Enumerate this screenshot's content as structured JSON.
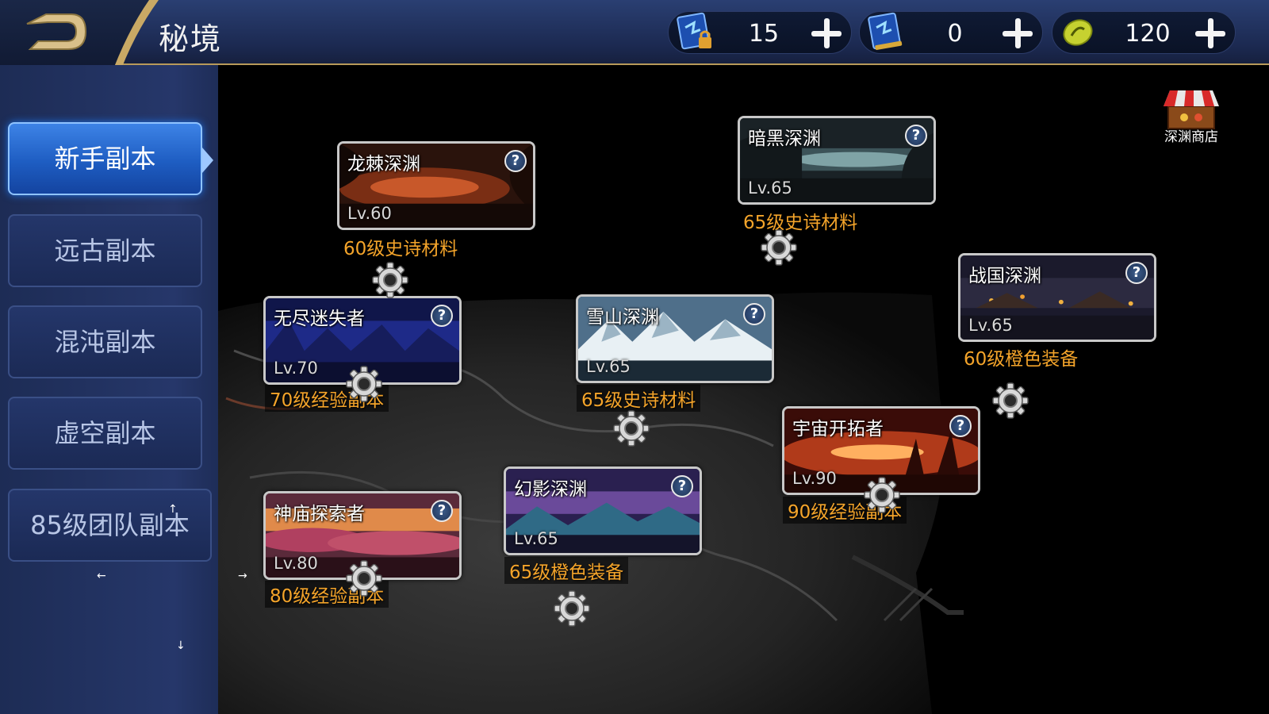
{
  "header": {
    "title": "秘境",
    "back_icon": "back-arrow-icon",
    "resources": [
      {
        "name": "locked-ticket",
        "icon": "locked-scroll-icon",
        "value": "15"
      },
      {
        "name": "ticket",
        "icon": "scroll-icon",
        "value": "0"
      },
      {
        "name": "currency",
        "icon": "coin-icon",
        "value": "120"
      }
    ]
  },
  "sidebar": {
    "items": [
      {
        "label": "新手副本",
        "active": true
      },
      {
        "label": "远古副本",
        "active": false
      },
      {
        "label": "混沌副本",
        "active": false
      },
      {
        "label": "虚空副本",
        "active": false
      },
      {
        "label": "85级团队副本",
        "active": false
      }
    ],
    "arrows": {
      "up": "↑",
      "left": "←",
      "right": "→",
      "down": "↓"
    }
  },
  "shop": {
    "label": "深渊商店",
    "icon": "shop-stall-icon"
  },
  "dungeons": [
    {
      "name": "龙棘深渊",
      "level": "Lv.60",
      "reward": "60级史诗材料",
      "theme": "fire-cave"
    },
    {
      "name": "暗黑深渊",
      "level": "Lv.65",
      "reward": "65级史诗材料",
      "theme": "dark-lake"
    },
    {
      "name": "战国深渊",
      "level": "Lv.65",
      "reward": "60级橙色装备",
      "theme": "night-city"
    },
    {
      "name": "无尽迷失者",
      "level": "Lv.70",
      "reward": "70级经验副本",
      "theme": "blue-forest"
    },
    {
      "name": "雪山深渊",
      "level": "Lv.65",
      "reward": "65级史诗材料",
      "theme": "snow-mountain"
    },
    {
      "name": "宇宙开拓者",
      "level": "Lv.90",
      "reward": "90级经验副本",
      "theme": "red-sunset"
    },
    {
      "name": "神庙探索者",
      "level": "Lv.80",
      "reward": "80级经验副本",
      "theme": "pink-clouds"
    },
    {
      "name": "幻影深渊",
      "level": "Lv.65",
      "reward": "65级橙色装备",
      "theme": "purple-ice"
    }
  ],
  "help_symbol": "?",
  "colors": {
    "reward_text": "#f4a42a",
    "active_tab": "#2a6fd6",
    "header_bg": "#1c2a52",
    "gold_trim": "#b89a5a"
  }
}
